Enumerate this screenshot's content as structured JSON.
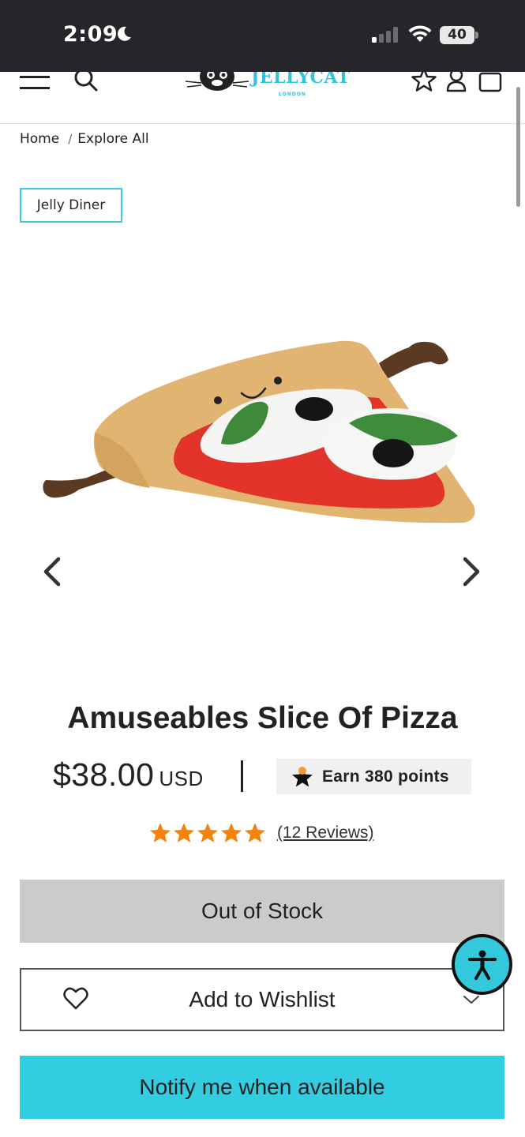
{
  "status_bar": {
    "time": "2:09",
    "battery": "40"
  },
  "header": {
    "logo_text": "JELLYCAT",
    "logo_subtext": "LONDON"
  },
  "breadcrumb": {
    "items": [
      "Home",
      "Explore All"
    ],
    "separator": "/"
  },
  "collection_tag": "Jelly Diner",
  "product": {
    "title": "Amuseables Slice Of Pizza",
    "price": "$38.00",
    "currency": "USD",
    "points_label": "Earn 380 points",
    "rating": 5,
    "reviews_label": "(12 Reviews)"
  },
  "buttons": {
    "out_of_stock": "Out of Stock",
    "wishlist": "Add to Wishlist",
    "notify": "Notify me when available"
  },
  "colors": {
    "accent": "#33cde1",
    "star": "#f5820d",
    "status_bar": "#25252a"
  },
  "icons": [
    "menu-icon",
    "search-icon",
    "star-icon",
    "account-icon",
    "bag-icon",
    "chevron-left-icon",
    "chevron-right-icon",
    "heart-icon",
    "chevron-down-icon",
    "accessibility-icon"
  ]
}
